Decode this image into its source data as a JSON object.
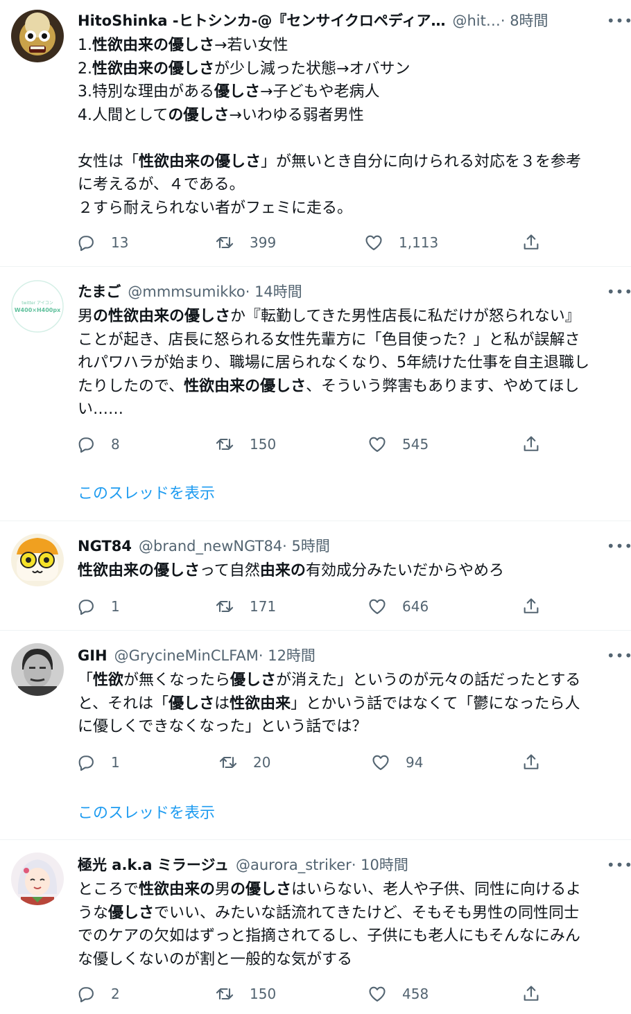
{
  "tweets": [
    {
      "name": "HitoShinka -ヒトシンカ-@『センサイクロペディア…",
      "handle": "@hit…",
      "time": " · 8時間",
      "lines": [
        [
          {
            "t": "1."
          },
          {
            "t": "性欲由来の優しさ",
            "b": true
          },
          {
            "t": "→若い女性"
          }
        ],
        [
          {
            "t": "2."
          },
          {
            "t": "性欲由来の優しさ",
            "b": true
          },
          {
            "t": "が少し減った状態→オバサン"
          }
        ],
        [
          {
            "t": "3.特別な理由がある"
          },
          {
            "t": "優しさ",
            "b": true
          },
          {
            "t": "→子どもや老病人"
          }
        ],
        [
          {
            "t": "4.人間として"
          },
          {
            "t": "の優しさ",
            "b": true
          },
          {
            "t": "→いわゆる弱者男性"
          }
        ],
        [],
        [
          {
            "t": "女性は「"
          },
          {
            "t": "性欲由来の優しさ",
            "b": true
          },
          {
            "t": "」が無いとき自分に向けられる対応を３を参考"
          }
        ],
        [
          {
            "t": "に考えるが、４である。"
          }
        ],
        [
          {
            "t": "２すら耐えられない者がフェミに走る。"
          }
        ]
      ],
      "replies": "13",
      "retweets": "399",
      "likes": "1,113"
    },
    {
      "name": "たまご",
      "handle": "@mmmsumikko",
      "time": " · 14時間",
      "avatar_text": [
        "twitter アイコン",
        "W400×H400px"
      ],
      "lines": [
        [
          {
            "t": "男"
          },
          {
            "t": "の性欲由来の優しさ",
            "b": true
          },
          {
            "t": "か『転勤してきた男性店長に私だけが怒られない』"
          }
        ],
        [
          {
            "t": "ことが起き、店長に怒られる女性先輩方に「色目使った？」と私が誤解さ"
          }
        ],
        [
          {
            "t": "れパワハラが始まり、職場に居られなくなり、5年続けた仕事を自主退職し"
          }
        ],
        [
          {
            "t": "たりしたので、"
          },
          {
            "t": "性欲由来の優しさ",
            "b": true
          },
          {
            "t": "、そういう弊害もあります、やめてほし"
          }
        ],
        [
          {
            "t": "い……"
          }
        ]
      ],
      "replies": "8",
      "retweets": "150",
      "likes": "545",
      "thread_link": "このスレッドを表示"
    },
    {
      "name": "NGT84",
      "handle": "@brand_newNGT84",
      "time": " · 5時間",
      "lines": [
        [
          {
            "t": "性欲由来の優しさ",
            "b": true
          },
          {
            "t": "って自然"
          },
          {
            "t": "由来の",
            "b": true
          },
          {
            "t": "有効成分みたいだからやめろ"
          }
        ]
      ],
      "replies": "1",
      "retweets": "171",
      "likes": "646"
    },
    {
      "name": "GIH",
      "handle": "@GrycineMinCLFAM",
      "time": " · 12時間",
      "lines": [
        [
          {
            "t": "「"
          },
          {
            "t": "性欲",
            "b": true
          },
          {
            "t": "が無くなったら"
          },
          {
            "t": "優しさ",
            "b": true
          },
          {
            "t": "が消えた」というのが元々の話だったとする"
          }
        ],
        [
          {
            "t": "と、それは「"
          },
          {
            "t": "優しさ",
            "b": true
          },
          {
            "t": "は"
          },
          {
            "t": "性欲由来",
            "b": true
          },
          {
            "t": "」とかいう話ではなくて「鬱になったら人"
          }
        ],
        [
          {
            "t": "に優しくできなくなった」という話では？"
          }
        ]
      ],
      "replies": "1",
      "retweets": "20",
      "likes": "94",
      "thread_link": "このスレッドを表示"
    },
    {
      "name": "極光 a.k.a ミラージュ",
      "handle": "@aurora_striker",
      "time": " · 10時間",
      "lines": [
        [
          {
            "t": "ところで"
          },
          {
            "t": "性欲由来の",
            "b": true
          },
          {
            "t": "男"
          },
          {
            "t": "の優しさ",
            "b": true
          },
          {
            "t": "はいらない、老人や子供、同性に向けるよ"
          }
        ],
        [
          {
            "t": "うな"
          },
          {
            "t": "優しさ",
            "b": true
          },
          {
            "t": "でいい、みたいな話流れてきたけど、そもそも男性の同性同士"
          }
        ],
        [
          {
            "t": "でのケアの欠如はずっと指摘されてるし、子供にも老人にもそんなにみん"
          }
        ],
        [
          {
            "t": "な優しくないのが割と一般的な気がする"
          }
        ]
      ],
      "replies": "2",
      "retweets": "150",
      "likes": "458"
    }
  ],
  "more_icon": "•••",
  "colors": {
    "link": "#1d9bf0",
    "secondary": "#536471",
    "divider": "#eff3f4"
  }
}
